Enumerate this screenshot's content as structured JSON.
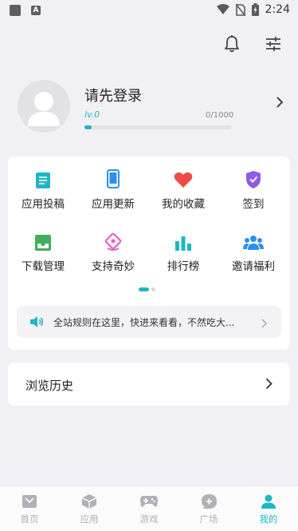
{
  "status_bar": {
    "time": "2:24"
  },
  "profile": {
    "login_prompt": "请先登录",
    "level": "lv.0",
    "exp": "0/1000",
    "exp_progress": 0.0
  },
  "grid": [
    {
      "label": "应用投稿",
      "icon": "document-icon",
      "color": "#1fb6c4"
    },
    {
      "label": "应用更新",
      "icon": "phone-icon",
      "color": "#2f8ff0"
    },
    {
      "label": "我的收藏",
      "icon": "heart-icon",
      "color": "#ee4a4a"
    },
    {
      "label": "签到",
      "icon": "shield-check-icon",
      "color": "#8c5ce6"
    },
    {
      "label": "下载管理",
      "icon": "download-tray-icon",
      "color": "#3fae5f"
    },
    {
      "label": "支持奇妙",
      "icon": "gift-icon",
      "color": "#e75fc0"
    },
    {
      "label": "排行榜",
      "icon": "bar-chart-icon",
      "color": "#1fb6c4"
    },
    {
      "label": "邀请福利",
      "icon": "group-icon",
      "color": "#2f8ff0"
    }
  ],
  "notice": {
    "text": "全站规则在这里，快进来看看，不然吃大..."
  },
  "history": {
    "label": "浏览历史"
  },
  "nav": [
    {
      "label": "首页",
      "icon": "home-icon"
    },
    {
      "label": "应用",
      "icon": "box-icon"
    },
    {
      "label": "游戏",
      "icon": "gamepad-icon"
    },
    {
      "label": "广场",
      "icon": "chat-plus-icon"
    },
    {
      "label": "我的",
      "icon": "user-icon",
      "active": true
    }
  ],
  "colors": {
    "accent": "#1fb6c4",
    "inactive": "#b0b0b6"
  }
}
